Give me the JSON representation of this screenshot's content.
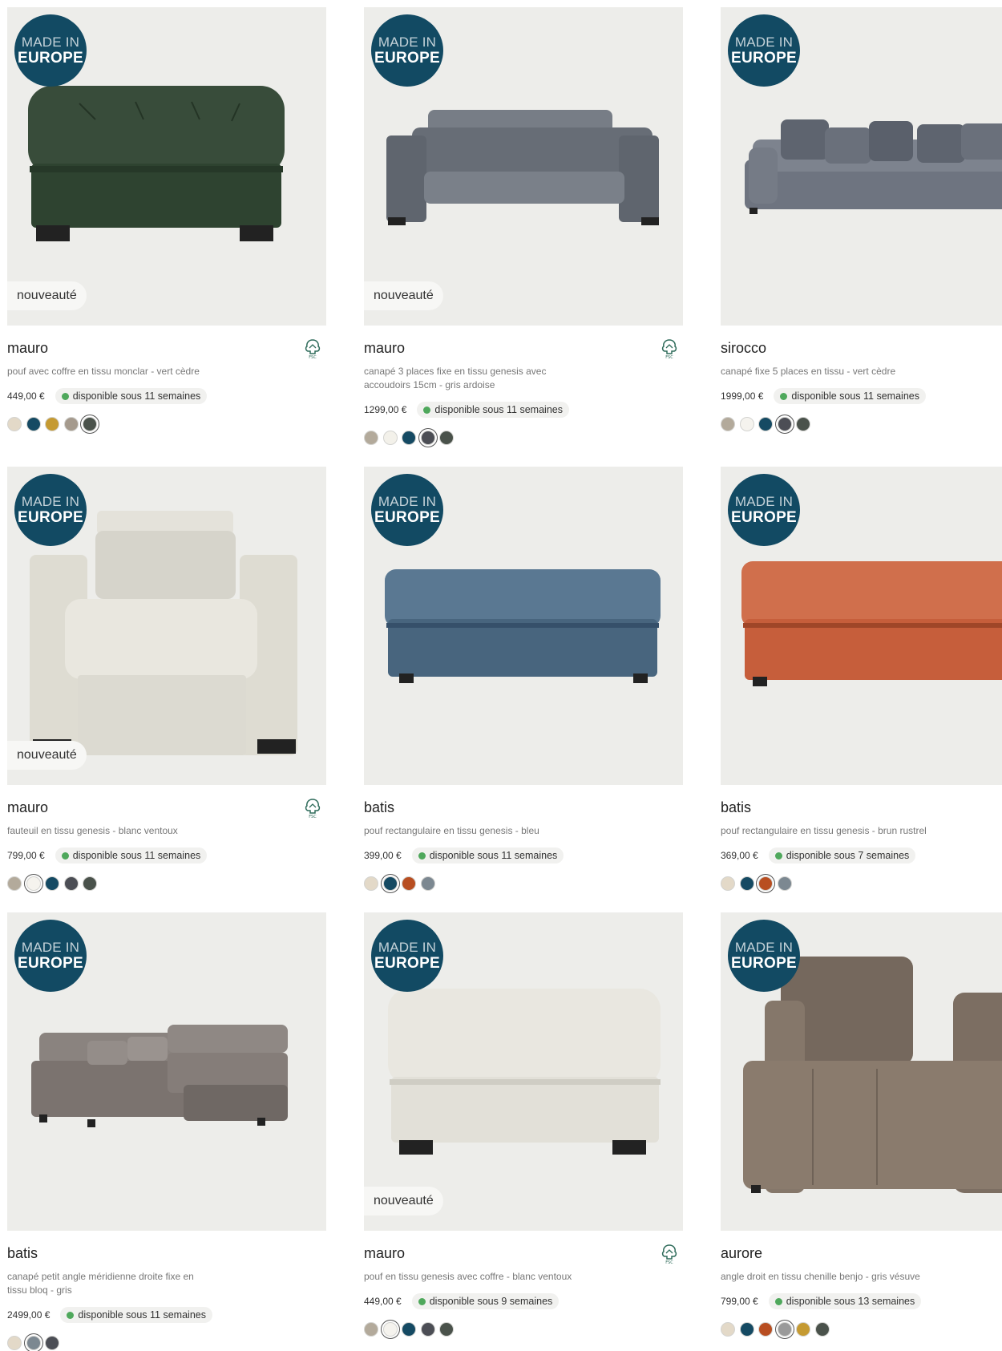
{
  "badges": {
    "made_in": "MADE IN",
    "europe": "EUROPE",
    "new": "nouveauté"
  },
  "products": [
    {
      "name": "mauro",
      "description": "pouf avec coffre en tissu monclar - vert cèdre",
      "price": "449,00 €",
      "availability": "disponible sous 11 semaines",
      "is_new": true,
      "fsc": true,
      "image": "green-tufted-ottoman",
      "product_color": "#2e4330",
      "swatches": [
        "#e3d9c8",
        "#154a63",
        "#c59a32",
        "#a59a8d",
        "#4a524b"
      ],
      "selected_swatch": 4
    },
    {
      "name": "mauro",
      "description": "canapé 3 places fixe en tissu genesis avec accoudoirs 15cm - gris ardoise",
      "price": "1299,00 €",
      "availability": "disponible sous 11 semaines",
      "is_new": true,
      "fsc": true,
      "image": "grey-3-seat-sofa",
      "product_color": "#676d76",
      "swatches": [
        "#b3aa9b",
        "#f3f1ea",
        "#154a63",
        "#4c4e55",
        "#4a524b"
      ],
      "selected_swatch": 3
    },
    {
      "name": "sirocco",
      "description": "canapé fixe 5 places en tissu - vert cèdre",
      "price": "1999,00 €",
      "availability": "disponible sous 11 semaines",
      "is_new": false,
      "fsc": false,
      "image": "grey-5-seat-sofa-cushions",
      "product_color": "#6e7480",
      "swatches": [
        "#b3aa9b",
        "#f5f3ee",
        "#154a63",
        "#4c4e55",
        "#4a524b"
      ],
      "selected_swatch": 3
    },
    {
      "name": "mauro",
      "description": "fauteuil en tissu genesis - blanc ventoux",
      "price": "799,00 €",
      "availability": "disponible sous 11 semaines",
      "is_new": true,
      "fsc": true,
      "image": "cream-armchair",
      "product_color": "#dedcd2",
      "swatches": [
        "#b3aa9b",
        "#f5f3ee",
        "#154a63",
        "#4c4e55",
        "#4a524b"
      ],
      "selected_swatch": 1
    },
    {
      "name": "batis",
      "description": "pouf rectangulaire en tissu genesis - bleu",
      "price": "399,00 €",
      "availability": "disponible sous 11 semaines",
      "is_new": false,
      "fsc": false,
      "image": "blue-rectangular-ottoman",
      "product_color": "#48657e",
      "swatches": [
        "#e3d9c8",
        "#154a63",
        "#b84e21",
        "#7c8891"
      ],
      "selected_swatch": 1
    },
    {
      "name": "batis",
      "description": "pouf rectangulaire en tissu genesis - brun rustrel",
      "price": "369,00 €",
      "availability": "disponible sous 7 semaines",
      "is_new": false,
      "fsc": false,
      "image": "orange-rectangular-ottoman",
      "product_color": "#c65e3b",
      "swatches": [
        "#e3d9c8",
        "#154a63",
        "#b84e21",
        "#7c8891"
      ],
      "selected_swatch": 2
    },
    {
      "name": "batis",
      "description": "canapé petit angle méridienne droite fixe en tissu bloq - gris",
      "price": "2499,00 €",
      "availability": "disponible sous 11 semaines",
      "is_new": false,
      "fsc": false,
      "image": "grey-corner-sofa",
      "product_color": "#7b736f",
      "swatches": [
        "#e3d9c8",
        "#7c8891",
        "#4c4e55"
      ],
      "selected_swatch": 1
    },
    {
      "name": "mauro",
      "description": "pouf en tissu genesis avec coffre - blanc ventoux",
      "price": "449,00 €",
      "availability": "disponible sous 9 semaines",
      "is_new": true,
      "fsc": true,
      "image": "cream-ottoman",
      "product_color": "#e2e0d8",
      "swatches": [
        "#b3aa9b",
        "#f5f3ee",
        "#154a63",
        "#4c4e55",
        "#4a524b"
      ],
      "selected_swatch": 1
    },
    {
      "name": "aurore",
      "description": "angle droit en tissu chenille benjo - gris vésuve",
      "price": "799,00 €",
      "availability": "disponible sous 13 semaines",
      "is_new": false,
      "fsc": false,
      "image": "taupe-corner-module",
      "product_color": "#8a7b6d",
      "swatches": [
        "#e3d9c8",
        "#154a63",
        "#b84e21",
        "#9a9a9a",
        "#c59a32",
        "#4a524b"
      ],
      "selected_swatch": 3
    }
  ]
}
